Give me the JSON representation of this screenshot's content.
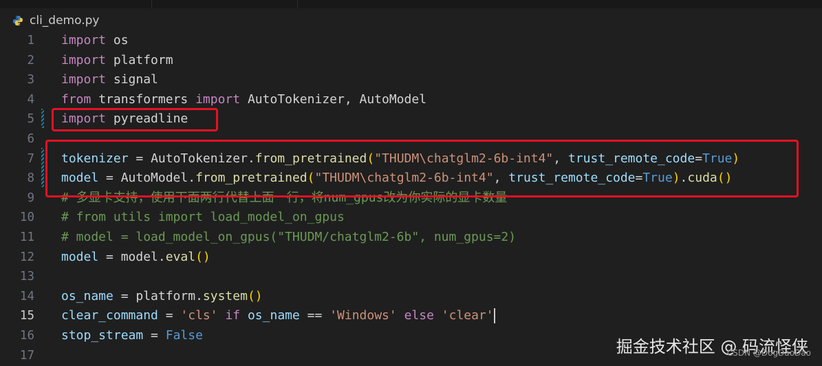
{
  "tab": {
    "filename": "cli_demo.py",
    "file_icon": "python-icon"
  },
  "editor": {
    "active_line": 15,
    "lines": [
      {
        "n": "1",
        "tokens": [
          [
            "kw",
            "import"
          ],
          [
            "id",
            " os"
          ]
        ]
      },
      {
        "n": "2",
        "tokens": [
          [
            "kw",
            "import"
          ],
          [
            "id",
            " platform"
          ]
        ]
      },
      {
        "n": "3",
        "tokens": [
          [
            "kw",
            "import"
          ],
          [
            "id",
            " signal"
          ]
        ]
      },
      {
        "n": "4",
        "tokens": [
          [
            "kw",
            "from"
          ],
          [
            "id",
            " transformers "
          ],
          [
            "kw",
            "import"
          ],
          [
            "id",
            " AutoTokenizer, AutoModel"
          ]
        ]
      },
      {
        "n": "5",
        "tokens": [
          [
            "kw",
            "import"
          ],
          [
            "id",
            " pyreadline"
          ]
        ]
      },
      {
        "n": "6",
        "tokens": []
      },
      {
        "n": "7",
        "tokens": [
          [
            "var",
            "tokenizer"
          ],
          [
            "op",
            " = "
          ],
          [
            "id",
            "AutoTokenizer."
          ],
          [
            "fn",
            "from_pretrained"
          ],
          [
            "paren",
            "("
          ],
          [
            "str",
            "\"THUDM\\chatglm2-6b-int4\""
          ],
          [
            "op",
            ", "
          ],
          [
            "var",
            "trust_remote_code"
          ],
          [
            "op",
            "="
          ],
          [
            "bool",
            "True"
          ],
          [
            "paren",
            ")"
          ]
        ]
      },
      {
        "n": "8",
        "tokens": [
          [
            "var",
            "model"
          ],
          [
            "op",
            " = "
          ],
          [
            "id",
            "AutoModel."
          ],
          [
            "fn",
            "from_pretrained"
          ],
          [
            "paren",
            "("
          ],
          [
            "str",
            "\"THUDM\\chatglm2-6b-int4\""
          ],
          [
            "op",
            ", "
          ],
          [
            "var",
            "trust_remote_code"
          ],
          [
            "op",
            "="
          ],
          [
            "bool",
            "True"
          ],
          [
            "paren",
            ")"
          ],
          [
            "id",
            "."
          ],
          [
            "fn",
            "cuda"
          ],
          [
            "paren",
            "()"
          ]
        ]
      },
      {
        "n": "9",
        "tokens": [
          [
            "cmt",
            "# 多显卡支持，使用下面两行代替上面一行，将num_gpus改为你实际的显卡数量"
          ]
        ]
      },
      {
        "n": "10",
        "tokens": [
          [
            "cmt",
            "# from utils import load_model_on_gpus"
          ]
        ]
      },
      {
        "n": "11",
        "tokens": [
          [
            "cmt",
            "# model = load_model_on_gpus(\"THUDM/chatglm2-6b\", num_gpus=2)"
          ]
        ]
      },
      {
        "n": "12",
        "tokens": [
          [
            "var",
            "model"
          ],
          [
            "op",
            " = "
          ],
          [
            "id",
            "model."
          ],
          [
            "fn",
            "eval"
          ],
          [
            "paren",
            "()"
          ]
        ]
      },
      {
        "n": "13",
        "tokens": []
      },
      {
        "n": "14",
        "tokens": [
          [
            "var",
            "os_name"
          ],
          [
            "op",
            " = "
          ],
          [
            "id",
            "platform."
          ],
          [
            "fn",
            "system"
          ],
          [
            "paren",
            "()"
          ]
        ]
      },
      {
        "n": "15",
        "tokens": [
          [
            "var",
            "clear_command"
          ],
          [
            "op",
            " = "
          ],
          [
            "str",
            "'cls'"
          ],
          [
            "op",
            " "
          ],
          [
            "kw",
            "if"
          ],
          [
            "op",
            " "
          ],
          [
            "var",
            "os_name"
          ],
          [
            "op",
            " == "
          ],
          [
            "str",
            "'Windows'"
          ],
          [
            "op",
            " "
          ],
          [
            "kw",
            "else"
          ],
          [
            "op",
            " "
          ],
          [
            "str",
            "'clear'"
          ]
        ]
      },
      {
        "n": "16",
        "tokens": [
          [
            "var",
            "stop_stream"
          ],
          [
            "op",
            " = "
          ],
          [
            "bool",
            "False"
          ]
        ]
      },
      {
        "n": "17",
        "tokens": []
      }
    ]
  },
  "overlay": {
    "watermark": "掘金技术社区 @ 码流怪侠",
    "csdn": "CSDN @DogDaoDao"
  },
  "colors": {
    "annotation_box": "#e81123",
    "background": "#1f1f1f"
  }
}
